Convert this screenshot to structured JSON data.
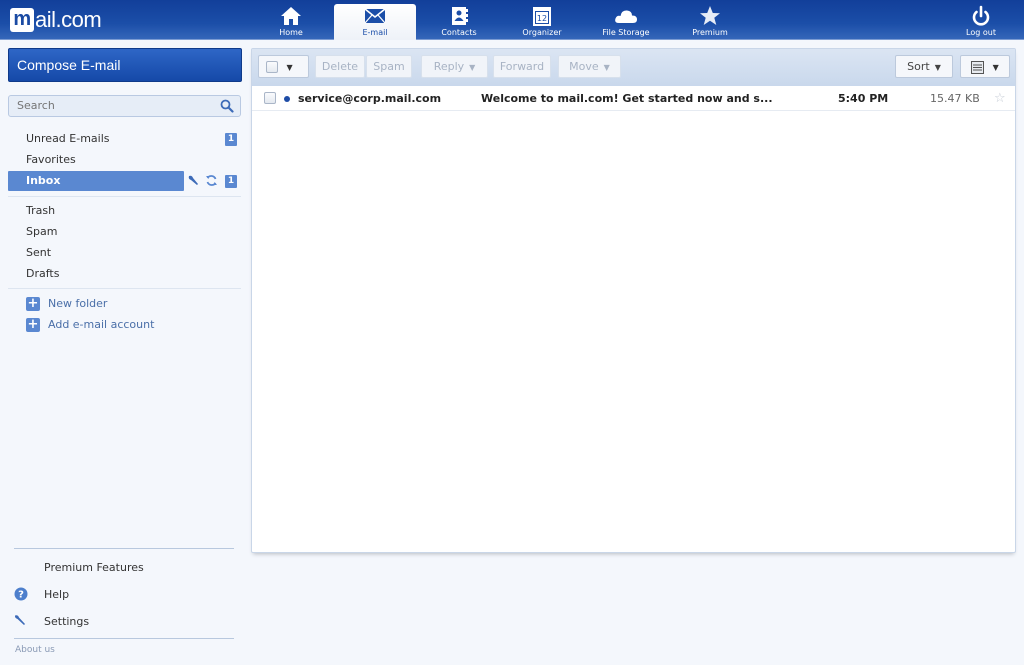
{
  "header": {
    "logo": {
      "box": "m",
      "text": "ail.com"
    },
    "nav": [
      {
        "label": "Home",
        "icon": "home-icon",
        "active": false
      },
      {
        "label": "E-mail",
        "icon": "envelope-icon",
        "active": true
      },
      {
        "label": "Contacts",
        "icon": "contacts-book-icon",
        "active": false
      },
      {
        "label": "Organizer",
        "icon": "calendar-icon",
        "active": false,
        "icon_text": "12"
      },
      {
        "label": "File Storage",
        "icon": "cloud-icon",
        "active": false
      },
      {
        "label": "Premium",
        "icon": "star-icon",
        "active": false
      }
    ],
    "logout": {
      "label": "Log out",
      "icon": "power-icon"
    }
  },
  "sidebar": {
    "compose_label": "Compose E-mail",
    "search_placeholder": "Search",
    "special_folders": [
      {
        "label": "Unread E-mails",
        "count": "1"
      },
      {
        "label": "Favorites"
      },
      {
        "label": "Inbox",
        "count": "1",
        "selected": true
      }
    ],
    "folders": [
      {
        "label": "Trash"
      },
      {
        "label": "Spam"
      },
      {
        "label": "Sent"
      },
      {
        "label": "Drafts"
      }
    ],
    "actions": [
      {
        "label": "New folder"
      },
      {
        "label": "Add e-mail account"
      }
    ],
    "footer": {
      "premium": "Premium Features",
      "help": "Help",
      "settings": "Settings",
      "about": "About us"
    }
  },
  "toolbar": {
    "delete": "Delete",
    "spam": "Spam",
    "reply": "Reply",
    "forward": "Forward",
    "move": "Move",
    "sort": "Sort",
    "caret": "▼"
  },
  "messages": [
    {
      "sender": "service@corp.mail.com",
      "subject": "Welcome to mail.com! Get started now and s...",
      "time": "5:40 PM",
      "size": "15.47 KB",
      "unread": true,
      "starred": false
    }
  ],
  "colors": {
    "brand": "#1b4ea8",
    "selected": "#5a88d1",
    "background": "#f4f7fc"
  }
}
